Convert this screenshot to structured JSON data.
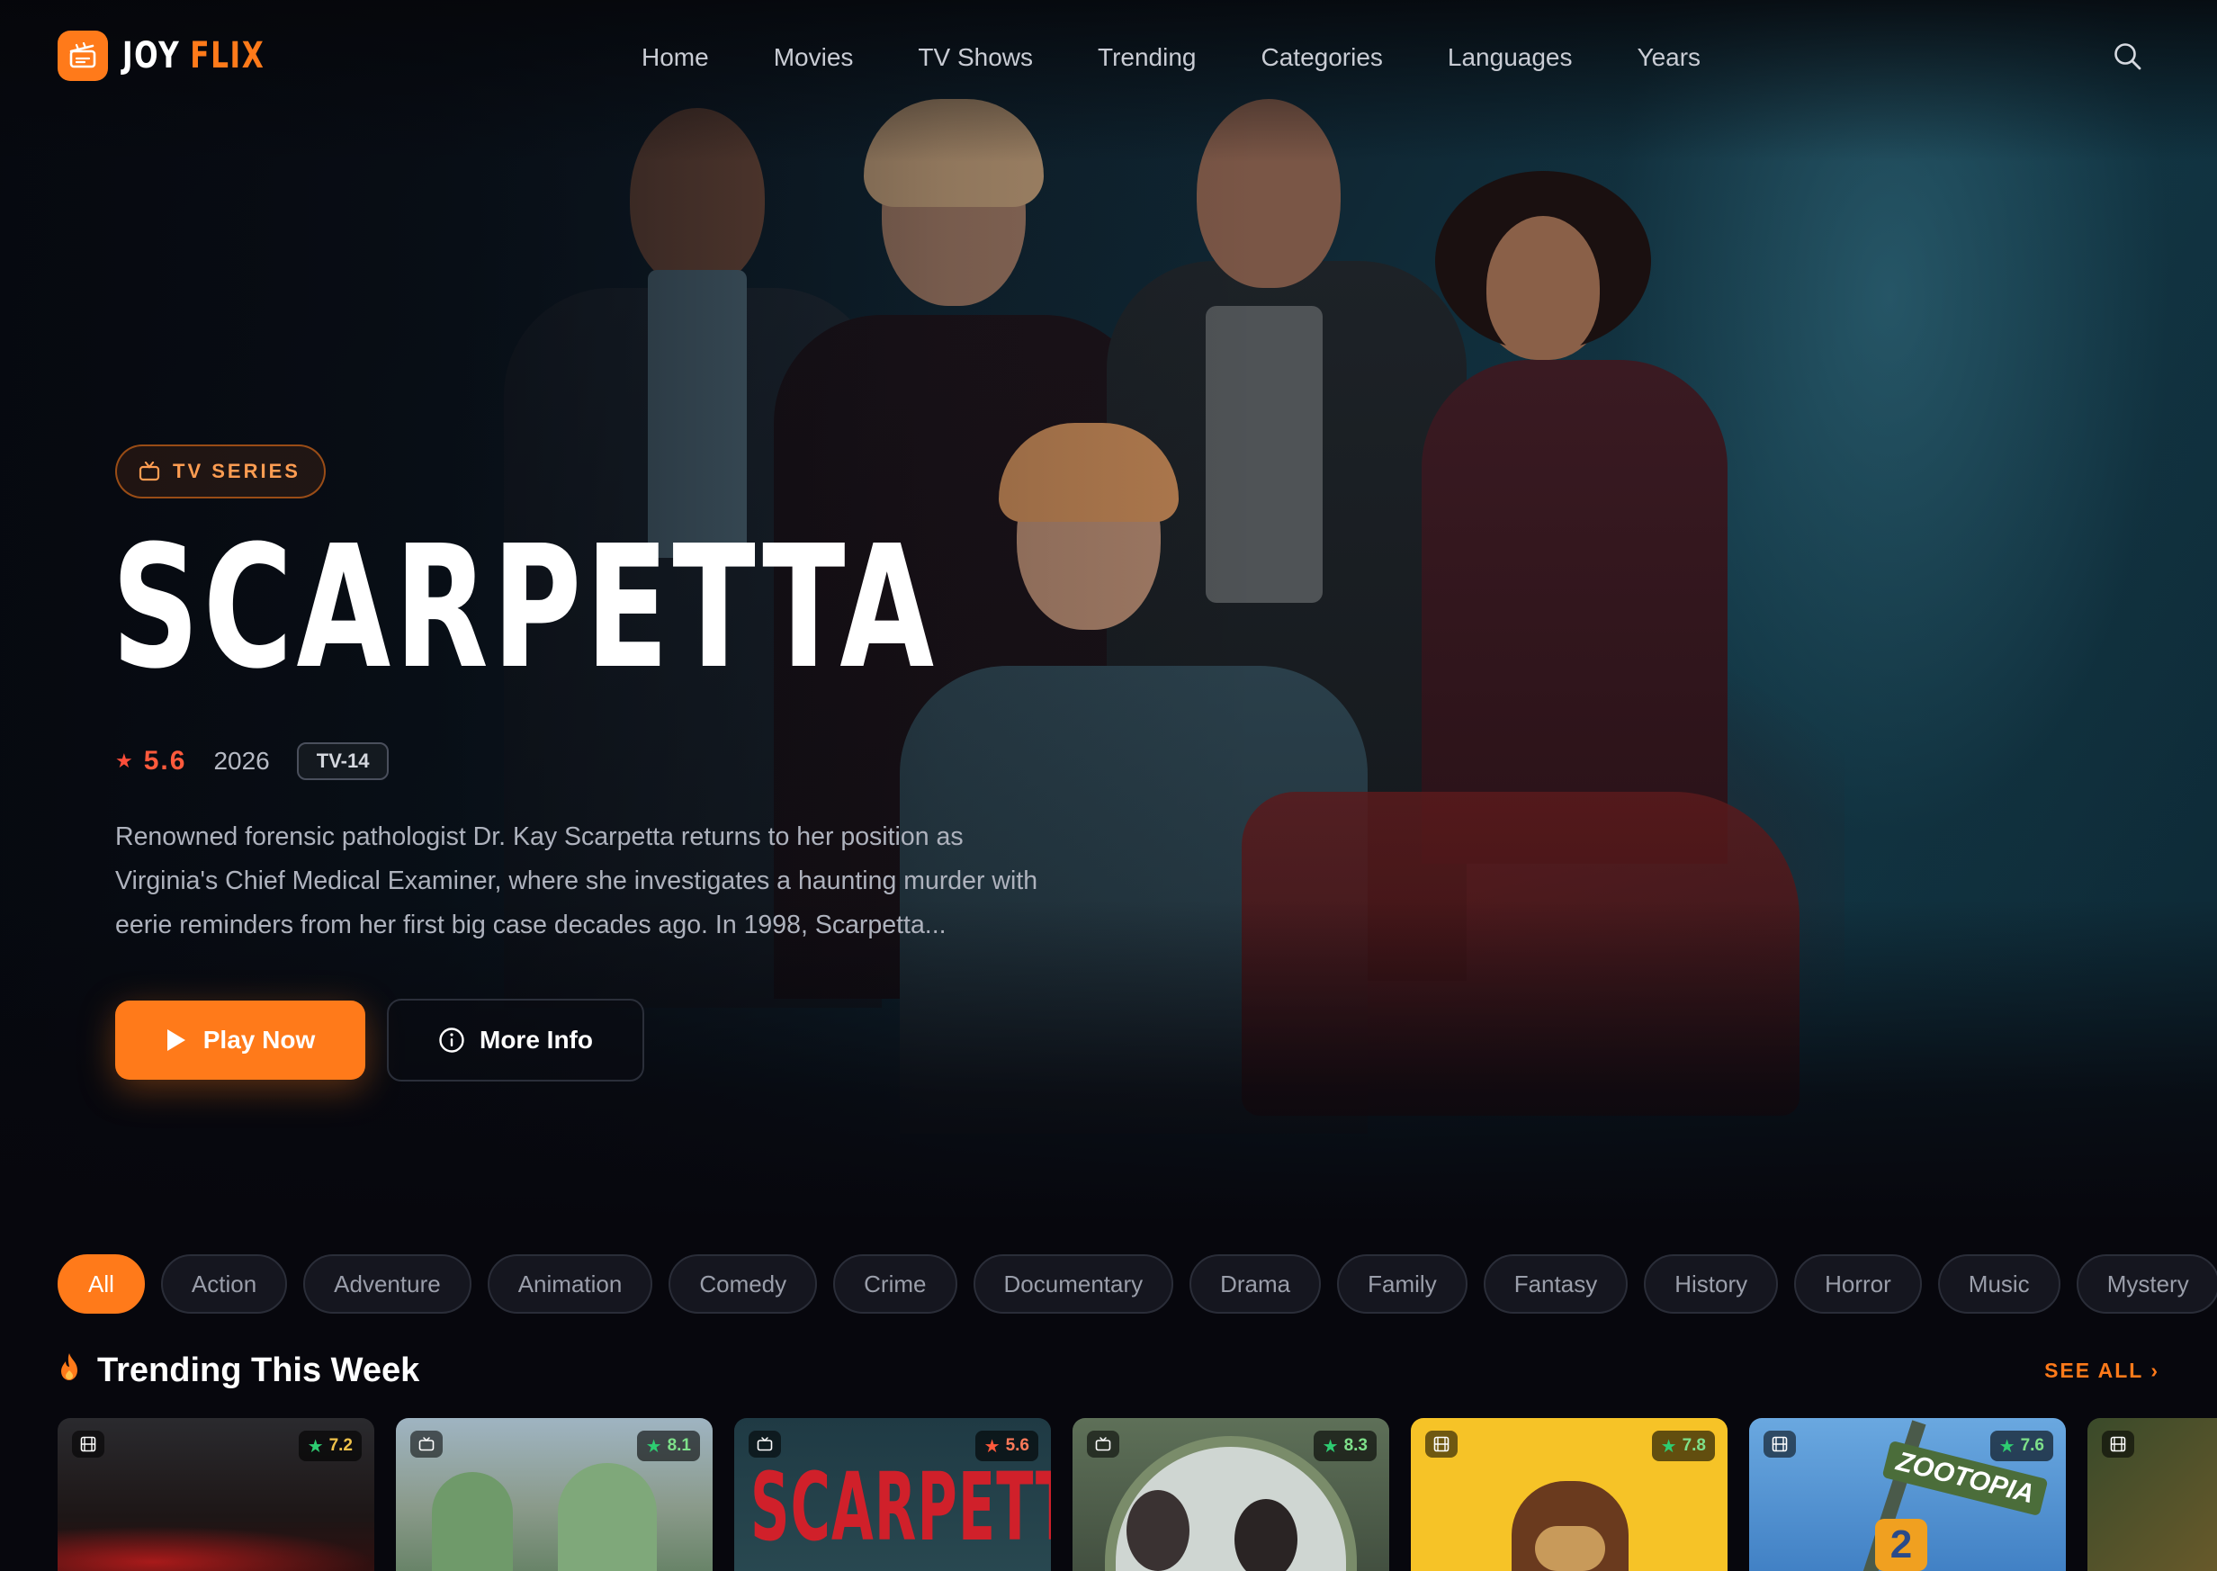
{
  "brand": {
    "name_part1": "JOY",
    "name_part2": "FLIX",
    "accent": "#ff7a1a"
  },
  "nav": {
    "items": [
      "Home",
      "Movies",
      "TV Shows",
      "Trending",
      "Categories",
      "Languages",
      "Years"
    ],
    "search_icon": "search-icon"
  },
  "hero": {
    "badge": "TV SERIES",
    "title": "SCARPETTA",
    "rating": "5.6",
    "year": "2026",
    "certification": "TV-14",
    "description": "Renowned forensic pathologist Dr. Kay Scarpetta returns to her position as Virginia's Chief Medical Examiner, where she investigates a haunting murder with eerie reminders from her first big case decades ago. In 1998, Scarpetta...",
    "play_label": "Play Now",
    "info_label": "More Info"
  },
  "genres": {
    "items": [
      "All",
      "Action",
      "Adventure",
      "Animation",
      "Comedy",
      "Crime",
      "Documentary",
      "Drama",
      "Family",
      "Fantasy",
      "History",
      "Horror",
      "Music",
      "Mystery"
    ],
    "active": "All"
  },
  "trending": {
    "title": "Trending This Week",
    "see_all": "SEE ALL ›",
    "cards": [
      {
        "type": "movie",
        "rating": "7.2"
      },
      {
        "type": "tv",
        "rating": "8.1"
      },
      {
        "type": "tv",
        "rating": "5.6",
        "poster_text": "SCARPETTA"
      },
      {
        "type": "tv",
        "rating": "8.3"
      },
      {
        "type": "movie",
        "rating": "7.8"
      },
      {
        "type": "movie",
        "rating": "7.6",
        "poster_text": "ZOOTOPIA",
        "poster_number": "2"
      },
      {
        "type": "movie",
        "rating": ""
      }
    ]
  }
}
